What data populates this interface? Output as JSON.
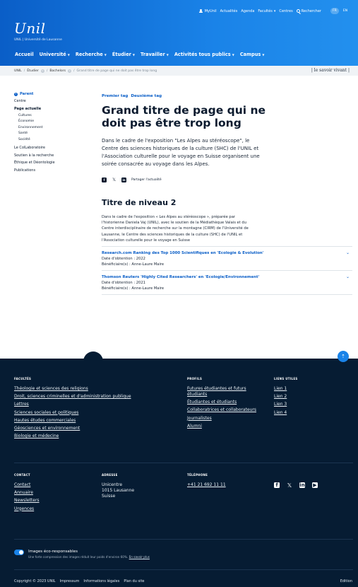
{
  "header": {
    "topbar": [
      "MyUnil",
      "Actualités",
      "Agenda",
      "Facultés",
      "Centres",
      "Rechercher"
    ],
    "facultes_chevron": "▾",
    "lang": [
      "FR",
      "EN"
    ],
    "logo_script": "Unil",
    "logo_sub": "UNIL | Université de Lausanne",
    "nav": [
      "Accueil",
      "Université",
      "Recherche",
      "Étudier",
      "Travailler",
      "Activités tous publics",
      "Campus"
    ]
  },
  "breadcrumb": {
    "items": [
      "UNIL",
      "Étudier",
      "Bachelors"
    ],
    "current": "Grand titre de page qui ne doit pas être trop long",
    "slogan": "| le savoir vivant |"
  },
  "sidebar": {
    "parent": "Parent",
    "centre": "Centre",
    "current": "Page actuelle",
    "sub": [
      "Cultures",
      "Économie",
      "Environnement",
      "Santé",
      "Société"
    ],
    "others": [
      "Le ColLaboratoire",
      "Soutien à la recherche",
      "Éthique et Déontologie",
      "Publications"
    ]
  },
  "content": {
    "tags": [
      "Premier tag",
      "Deuxième tag"
    ],
    "title": "Grand titre de page qui ne doit pas être trop long",
    "lead": "Dans le cadre de l'exposition \"Les Alpes au stéréoscope\", le Centre des sciences historiques de la culture (SHC) de l'UNIL et l'Association culturelle pour le voyage en Suisse organisent une soirée consacrée au voyage dans les Alpes.",
    "share_label": "Partager l'actualité",
    "h2": "Titre de niveau 2",
    "body": "Dans le cadre de l'exposition « Les Alpes au stéréoscope », préparée par l'historienne Daniela Vaj (UNIL), avec le soutien de la Médiathèque Valais et du Centre interdisciplinaire de recherche sur la montagne (CIRM) de l'Université de Lausanne, le Centre des sciences historiques de la culture (SHC) de l'UNIL et l'Association culturelle pour le voyage en Suisse",
    "accordions": [
      {
        "title": "Research.com Ranking des Top 1000 Scientifiques en 'Ecologie & Evolution'",
        "date": "Date d'obtention : 2022",
        "benef": "Bénéficiaire(s) : Anne-Laure Maire"
      },
      {
        "title": "Thomson Reuters 'Highly Cited Researchers' en 'Ecologie/Environnement'",
        "date": "Date d'obtention : 2021",
        "benef": "Bénéficiaire(s) : Anne-Laure Maire"
      }
    ]
  },
  "footer": {
    "facultes_h": "FACULTÉS",
    "facultes": [
      "Théologie et sciences des religions",
      "Droit, sciences criminelles et d'administration publique",
      "Lettres",
      "Sciences sociales et politiques",
      "Hautes études commerciales",
      "Géosciences et environnement",
      "Biologie et médecine"
    ],
    "profils_h": "PROFILS",
    "profils": [
      "Futures étudiantes et futurs étudiants",
      "Étudiantes et étudiants",
      "Collaboratrices et collaborateurs",
      "Journalistes",
      "Alumni"
    ],
    "liens_h": "LIENS UTILES",
    "liens": [
      "Lien 1",
      "Lien 2",
      "Lien 3",
      "Lien 4"
    ],
    "contact_h": "CONTACT",
    "contact": [
      "Contact",
      "Annuaire",
      "Newsletters",
      "Urgences"
    ],
    "adresse_h": "ADRESSE",
    "adresse": [
      "Unicentre",
      "1015 Lausanne",
      "Suisse"
    ],
    "tel_h": "TÉLÉPHONE",
    "tel": "+41 21 692 11 11",
    "eco_title": "Images éco-responsables",
    "eco_sub": "Une forte compression des images réduit leur poids d'environ 60%.",
    "eco_link": "En savoir plus",
    "bottom": [
      "Copyright © 2023 UNIL",
      "Impressum",
      "Informations légales",
      "Plan du site"
    ],
    "edition": "Edition"
  }
}
